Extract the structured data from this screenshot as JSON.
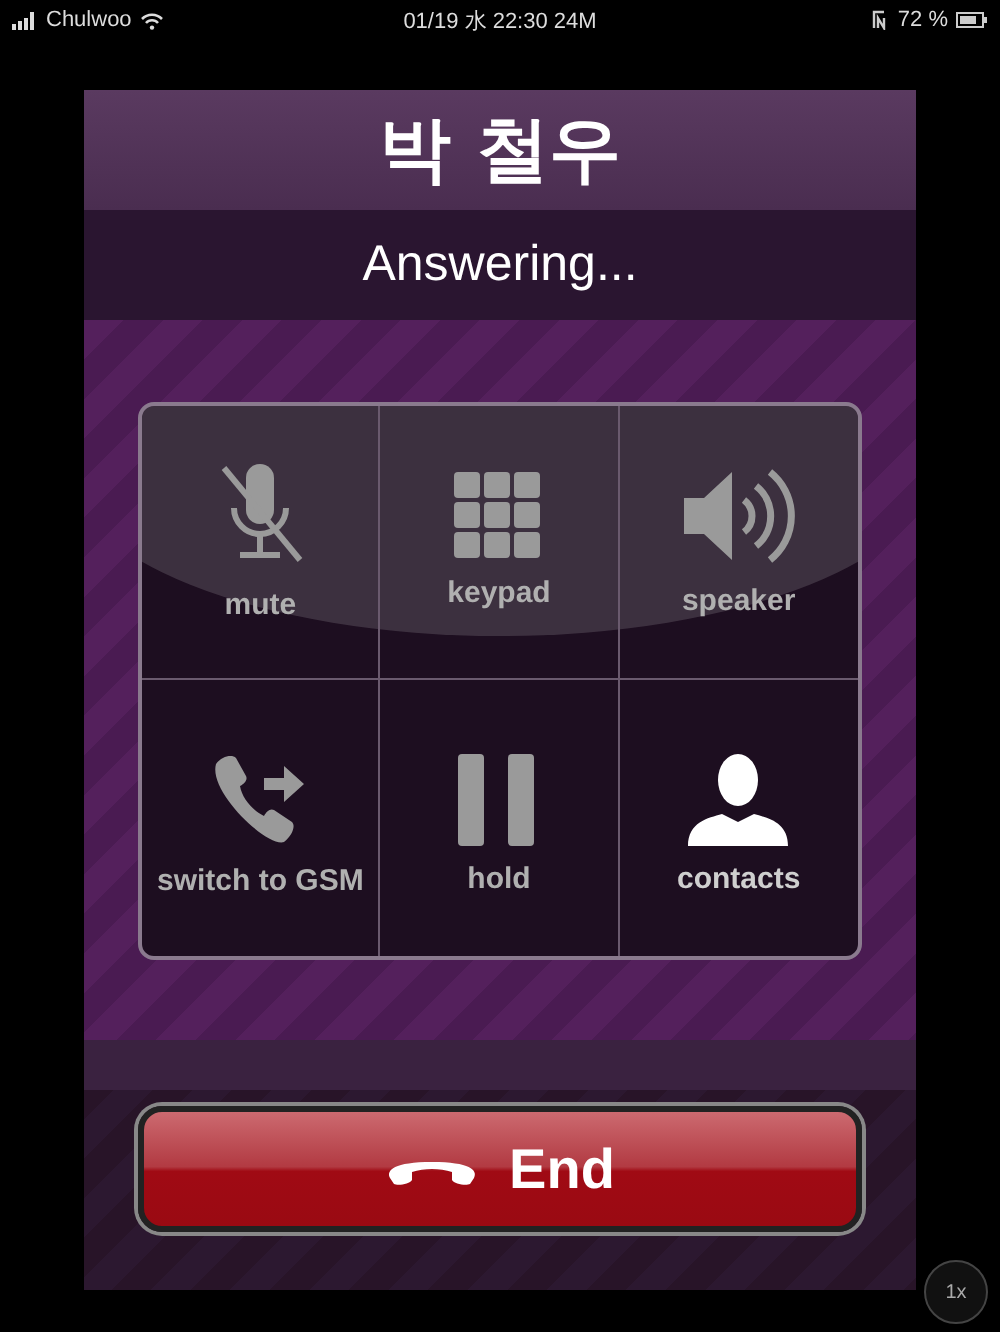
{
  "status_bar": {
    "carrier": "Chulwoo",
    "clock": "01/19 水 22:30 24M",
    "battery": "72 %"
  },
  "caller": {
    "name": "박 철우",
    "status": "Answering..."
  },
  "buttons": [
    {
      "kind": "mute",
      "label": "mute"
    },
    {
      "kind": "keypad",
      "label": "keypad"
    },
    {
      "kind": "speaker",
      "label": "speaker"
    },
    {
      "kind": "switch",
      "label": "switch to GSM"
    },
    {
      "kind": "hold",
      "label": "hold"
    },
    {
      "kind": "contacts",
      "label": "contacts"
    }
  ],
  "end_button": {
    "label": "End"
  },
  "zoom_button": {
    "label": "1x"
  }
}
